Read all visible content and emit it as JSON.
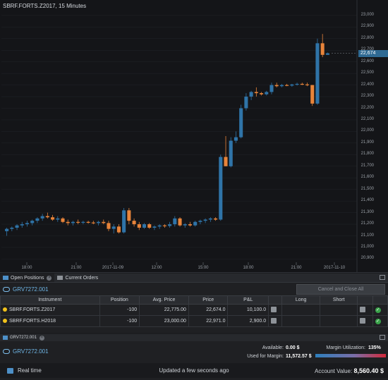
{
  "chart": {
    "title": "SBRF.FORTS.Z2017, 15 Minutes",
    "current_price_label": "22,674",
    "y_ticks": [
      "23,000",
      "22,900",
      "22,800",
      "22,700",
      "22,600",
      "22,500",
      "22,400",
      "22,300",
      "22,200",
      "22,100",
      "22,000",
      "21,900",
      "21,800",
      "21,700",
      "21,600",
      "21,500",
      "21,400",
      "21,300",
      "21,200",
      "21,100",
      "21,000",
      "20,900"
    ],
    "x_ticks": [
      "18:00",
      "21:00",
      "2017-11-09",
      "12:00",
      "15:00",
      "18:00",
      "21:00",
      "2017-11-10"
    ],
    "colors": {
      "up": "#2f74a8",
      "down": "#e8843a",
      "background": "#141518",
      "grid": "#22252a"
    }
  },
  "chart_data": {
    "type": "candlestick",
    "title": "SBRF.FORTS.Z2017, 15 Minutes",
    "ylim": [
      20860,
      23060
    ],
    "candles": [
      {
        "o": 21140,
        "h": 21170,
        "l": 21100,
        "c": 21160
      },
      {
        "o": 21160,
        "h": 21180,
        "l": 21140,
        "c": 21170
      },
      {
        "o": 21170,
        "h": 21200,
        "l": 21150,
        "c": 21190
      },
      {
        "o": 21190,
        "h": 21220,
        "l": 21170,
        "c": 21200
      },
      {
        "o": 21200,
        "h": 21230,
        "l": 21180,
        "c": 21210
      },
      {
        "o": 21210,
        "h": 21240,
        "l": 21190,
        "c": 21230
      },
      {
        "o": 21230,
        "h": 21260,
        "l": 21210,
        "c": 21250
      },
      {
        "o": 21250,
        "h": 21290,
        "l": 21230,
        "c": 21270
      },
      {
        "o": 21270,
        "h": 21300,
        "l": 21250,
        "c": 21260
      },
      {
        "o": 21260,
        "h": 21280,
        "l": 21230,
        "c": 21240
      },
      {
        "o": 21240,
        "h": 21270,
        "l": 21220,
        "c": 21250
      },
      {
        "o": 21250,
        "h": 21260,
        "l": 21210,
        "c": 21220
      },
      {
        "o": 21220,
        "h": 21240,
        "l": 21190,
        "c": 21210
      },
      {
        "o": 21210,
        "h": 21230,
        "l": 21190,
        "c": 21220
      },
      {
        "o": 21220,
        "h": 21240,
        "l": 21200,
        "c": 21215
      },
      {
        "o": 21215,
        "h": 21230,
        "l": 21200,
        "c": 21220
      },
      {
        "o": 21220,
        "h": 21230,
        "l": 21205,
        "c": 21215
      },
      {
        "o": 21215,
        "h": 21230,
        "l": 21200,
        "c": 21210
      },
      {
        "o": 21210,
        "h": 21230,
        "l": 21190,
        "c": 21220
      },
      {
        "o": 21220,
        "h": 21240,
        "l": 21200,
        "c": 21210
      },
      {
        "o": 21210,
        "h": 21230,
        "l": 21140,
        "c": 21160
      },
      {
        "o": 21160,
        "h": 21200,
        "l": 21120,
        "c": 21180
      },
      {
        "o": 21180,
        "h": 21200,
        "l": 21120,
        "c": 21130
      },
      {
        "o": 21130,
        "h": 21340,
        "l": 21120,
        "c": 21320
      },
      {
        "o": 21320,
        "h": 21340,
        "l": 21200,
        "c": 21230
      },
      {
        "o": 21230,
        "h": 21250,
        "l": 21180,
        "c": 21200
      },
      {
        "o": 21200,
        "h": 21220,
        "l": 21150,
        "c": 21170
      },
      {
        "o": 21170,
        "h": 21210,
        "l": 21160,
        "c": 21200
      },
      {
        "o": 21200,
        "h": 21210,
        "l": 21160,
        "c": 21170
      },
      {
        "o": 21170,
        "h": 21190,
        "l": 21150,
        "c": 21180
      },
      {
        "o": 21180,
        "h": 21200,
        "l": 21160,
        "c": 21190
      },
      {
        "o": 21190,
        "h": 21200,
        "l": 21170,
        "c": 21185
      },
      {
        "o": 21185,
        "h": 21220,
        "l": 21170,
        "c": 21200
      },
      {
        "o": 21200,
        "h": 21270,
        "l": 21180,
        "c": 21250
      },
      {
        "o": 21250,
        "h": 21260,
        "l": 21180,
        "c": 21190
      },
      {
        "o": 21190,
        "h": 21210,
        "l": 21170,
        "c": 21200
      },
      {
        "o": 21200,
        "h": 21220,
        "l": 21180,
        "c": 21190
      },
      {
        "o": 21190,
        "h": 21230,
        "l": 21180,
        "c": 21220
      },
      {
        "o": 21220,
        "h": 21240,
        "l": 21200,
        "c": 21230
      },
      {
        "o": 21230,
        "h": 21250,
        "l": 21210,
        "c": 21240
      },
      {
        "o": 21240,
        "h": 21260,
        "l": 21220,
        "c": 21250
      },
      {
        "o": 21250,
        "h": 21260,
        "l": 21230,
        "c": 21240
      },
      {
        "o": 21240,
        "h": 21800,
        "l": 21230,
        "c": 21780
      },
      {
        "o": 21780,
        "h": 21960,
        "l": 21700,
        "c": 21700
      },
      {
        "o": 21700,
        "h": 21950,
        "l": 21690,
        "c": 21920
      },
      {
        "o": 21920,
        "h": 22000,
        "l": 21900,
        "c": 21950
      },
      {
        "o": 21950,
        "h": 22230,
        "l": 21940,
        "c": 22200
      },
      {
        "o": 22200,
        "h": 22330,
        "l": 22180,
        "c": 22300
      },
      {
        "o": 22300,
        "h": 22350,
        "l": 22270,
        "c": 22340
      },
      {
        "o": 22340,
        "h": 22380,
        "l": 22300,
        "c": 22330
      },
      {
        "o": 22330,
        "h": 22340,
        "l": 22310,
        "c": 22320
      },
      {
        "o": 22320,
        "h": 22350,
        "l": 22310,
        "c": 22340
      },
      {
        "o": 22340,
        "h": 22420,
        "l": 22320,
        "c": 22400
      },
      {
        "o": 22400,
        "h": 22420,
        "l": 22380,
        "c": 22390
      },
      {
        "o": 22390,
        "h": 22410,
        "l": 22380,
        "c": 22400
      },
      {
        "o": 22400,
        "h": 22410,
        "l": 22390,
        "c": 22395
      },
      {
        "o": 22395,
        "h": 22410,
        "l": 22385,
        "c": 22405
      },
      {
        "o": 22405,
        "h": 22420,
        "l": 22395,
        "c": 22410
      },
      {
        "o": 22410,
        "h": 22420,
        "l": 22400,
        "c": 22405
      },
      {
        "o": 22405,
        "h": 22420,
        "l": 22390,
        "c": 22400
      },
      {
        "o": 22400,
        "h": 22320,
        "l": 22220,
        "c": 22240
      },
      {
        "o": 22240,
        "h": 22800,
        "l": 22230,
        "c": 22760
      },
      {
        "o": 22760,
        "h": 22840,
        "l": 22640,
        "c": 22660
      },
      {
        "o": 22660,
        "h": 22680,
        "l": 22660,
        "c": 22674
      }
    ]
  },
  "positions_panel": {
    "tabs": [
      {
        "label": "Open Positions",
        "active": true
      },
      {
        "label": "Current Orders",
        "active": false
      }
    ],
    "account_id": "GRV7272.001",
    "close_all_label": "Cancel and Close All",
    "columns": [
      "Instrument",
      "Position",
      "Avg. Price",
      "Price",
      "P&L",
      "",
      "Long",
      "Short",
      "",
      ""
    ],
    "rows": [
      {
        "instrument": "SBRF.FORTS.Z2017",
        "position": "-100",
        "avg_price": "22,775.00",
        "price": "22,674.0",
        "pnl": "10,100.0"
      },
      {
        "instrument": "SBRF.FORTS.H2018",
        "position": "-100",
        "avg_price": "23,000.00",
        "price": "22,971.0",
        "pnl": "2,900.0"
      }
    ]
  },
  "account_panel": {
    "tab_label": "GRV7272.001",
    "account_id": "GRV7272.001",
    "available_label": "Available:",
    "available_value": "0.00 $",
    "used_margin_label": "Used for Margin:",
    "used_margin_value": "11,572.57 $",
    "margin_util_label": "Margin Utilization:",
    "margin_util_value": "135%",
    "account_value_label": "Account Value:",
    "account_value": "8,560.40 $"
  },
  "footer": {
    "realtime_label": "Real time",
    "status": "Updated a few seconds ago"
  }
}
